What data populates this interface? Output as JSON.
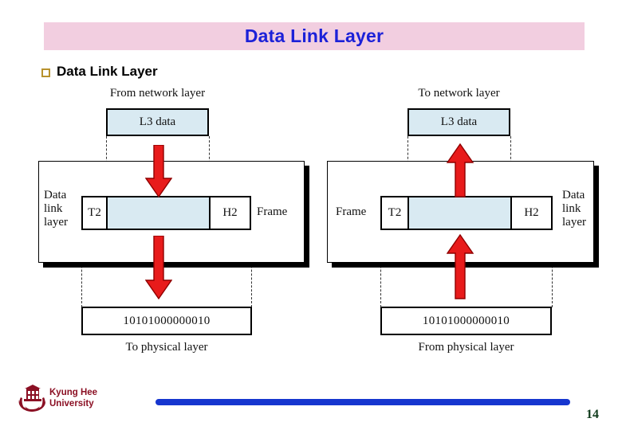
{
  "slide": {
    "title": "Data Link Layer",
    "title_bg": "#f2cee0",
    "title_color": "#1c21d8",
    "bullet_label": "Data Link Layer",
    "bullet_color": "#b8922d"
  },
  "colors": {
    "data_fill": "#d9eaf2",
    "arrow_red": "#e81b1b",
    "arrow_red_dark": "#a00000",
    "footer_bar": "#1636cf",
    "university_text": "#8b1024",
    "page_number": "#113c1d"
  },
  "diagram_left": {
    "name": "sending-side",
    "top_caption": "From network layer",
    "l3_box_label": "L3 data",
    "layer_label": "Data\nlink\nlayer",
    "layer_label_lines": [
      "Data",
      "link",
      "layer"
    ],
    "frame_trailer": "T2",
    "frame_header": "H2",
    "frame_label": "Frame",
    "bits": "10101000000010",
    "bottom_caption": "To physical layer",
    "arrow_direction": "down"
  },
  "diagram_right": {
    "name": "receiving-side",
    "top_caption": "To network layer",
    "l3_box_label": "L3 data",
    "layer_label_lines": [
      "Data",
      "link",
      "layer"
    ],
    "frame_trailer": "T2",
    "frame_header": "H2",
    "frame_label": "Frame",
    "bits": "10101000000010",
    "bottom_caption": "From physical layer",
    "arrow_direction": "up"
  },
  "footer": {
    "university_line1": "Kyung Hee",
    "university_line2": "University",
    "page_number": "14"
  }
}
